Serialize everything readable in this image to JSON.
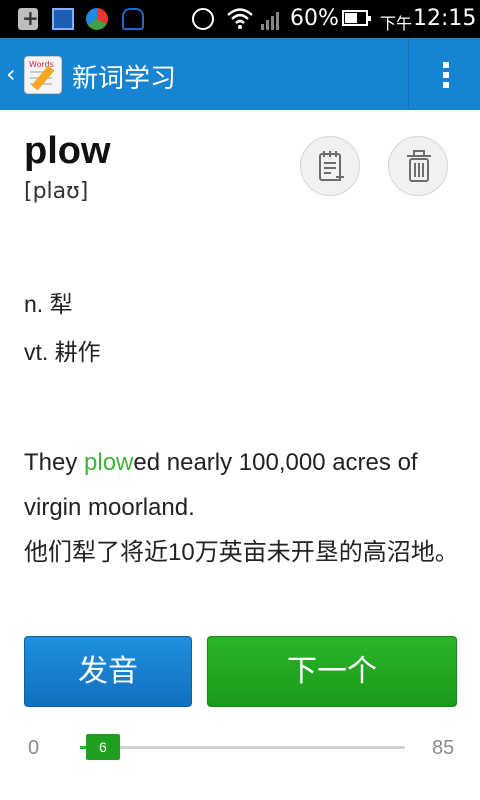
{
  "status_bar": {
    "battery": "60%",
    "battery_level": 0.6,
    "ampm": "下午",
    "time": "12:15"
  },
  "action_bar": {
    "back_glyph": "‹",
    "title": "新词学习"
  },
  "word": {
    "headword": "plow",
    "phonetic": "[plaʊ]"
  },
  "meanings": [
    "n. 犁",
    "vt. 耕作"
  ],
  "example": {
    "before": "They ",
    "highlight": "plow",
    "after": "ed nearly 100,000 acres of virgin moorland.",
    "translation": "他们犁了将近10万英亩未开垦的高沼地。"
  },
  "buttons": {
    "pronounce": "发音",
    "next": "下一个"
  },
  "progress": {
    "min": "0",
    "max": "85",
    "current": "6",
    "min_value": 0,
    "max_value": 85,
    "current_value": 6
  },
  "colors": {
    "action_bar": "#1784d3",
    "highlight": "#3fb33a",
    "pronounce_button": "#1784d3",
    "next_button": "#22a722"
  },
  "icons": {
    "add_to_notebook": "notebook-add-icon",
    "delete": "trash-icon",
    "overflow": "overflow-menu-icon"
  }
}
